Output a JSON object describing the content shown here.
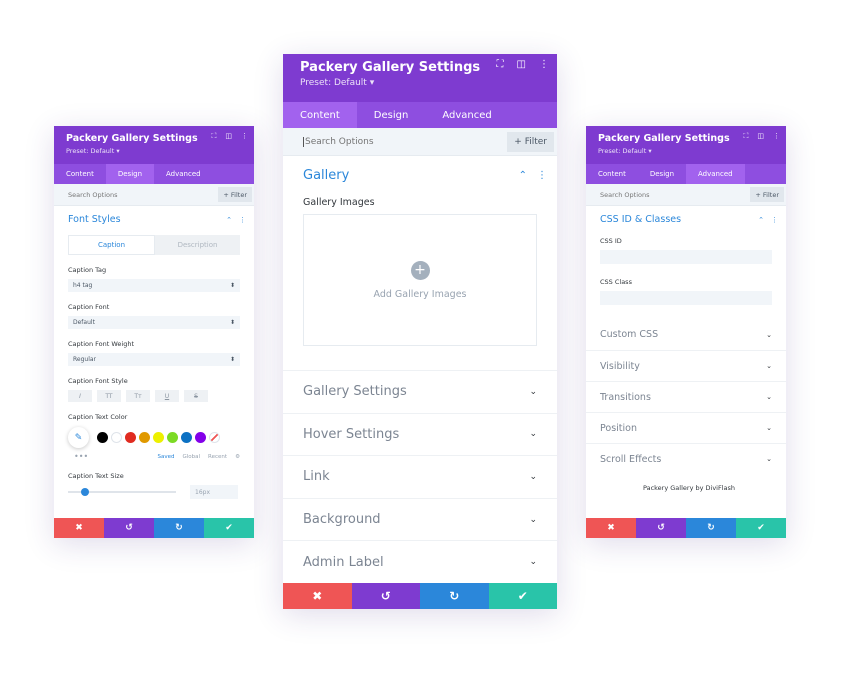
{
  "center": {
    "title": "Packery Gallery Settings",
    "preset": "Preset: Default",
    "preset_caret": "▾",
    "tabs": [
      "Content",
      "Design",
      "Advanced"
    ],
    "search_placeholder": "Search Options",
    "filter_label": "+ Filter",
    "gallery": {
      "title": "Gallery",
      "field_label": "Gallery Images",
      "add_label": "Add Gallery Images"
    },
    "sections": [
      "Gallery Settings",
      "Hover Settings",
      "Link",
      "Background",
      "Admin Label"
    ]
  },
  "left": {
    "title": "Packery Gallery Settings",
    "preset": "Preset: Default",
    "preset_caret": "▾",
    "tabs": [
      "Content",
      "Design",
      "Advanced"
    ],
    "search_placeholder": "Search Options",
    "filter_label": "+ Filter",
    "section_title": "Font Styles",
    "subtabs": [
      "Caption",
      "Description"
    ],
    "caption_tag": {
      "label": "Caption Tag",
      "value": "h4 tag"
    },
    "caption_font": {
      "label": "Caption Font",
      "value": "Default"
    },
    "caption_font_weight": {
      "label": "Caption Font Weight",
      "value": "Regular"
    },
    "caption_font_style": {
      "label": "Caption Font Style",
      "buttons": [
        "I",
        "TT",
        "Tт",
        "U",
        "S"
      ]
    },
    "caption_text_color": {
      "label": "Caption Text Color",
      "swatches": [
        "#000000",
        "#ffffff",
        "#e02b20",
        "#e09900",
        "#edf000",
        "#7cda24",
        "#0c71c3",
        "#8300e9"
      ],
      "saved": "Saved",
      "global": "Global",
      "recent": "Recent",
      "more": "•••"
    },
    "caption_text_size": {
      "label": "Caption Text Size",
      "value": "16px",
      "level": 0.12
    }
  },
  "right": {
    "title": "Packery Gallery Settings",
    "preset": "Preset: Default",
    "preset_caret": "▾",
    "tabs": [
      "Content",
      "Design",
      "Advanced"
    ],
    "search_placeholder": "Search Options",
    "filter_label": "+ Filter",
    "section_title": "CSS ID & Classes",
    "css_id_label": "CSS ID",
    "css_class_label": "CSS Class",
    "sections": [
      "Custom CSS",
      "Visibility",
      "Transitions",
      "Position",
      "Scroll Effects"
    ],
    "credit": "Packery Gallery by DiviFlash"
  },
  "icons": {
    "focus": "⛶",
    "split": "◫",
    "more": "⋮",
    "collapse": "⌃",
    "chevron": "⌄",
    "cancel": "✖",
    "undo": "↺",
    "redo": "↻",
    "save": "✔",
    "picker": "✎",
    "plus": "+",
    "gear": "⚙",
    "select": "⬍"
  },
  "colors": {
    "header": "#7e3bd0",
    "tabs": "#8e4ee0",
    "accent": "#2b87da",
    "cancel": "#ef5555",
    "undo": "#7e3bd0",
    "redo": "#2b87da",
    "save": "#29c4a9"
  }
}
